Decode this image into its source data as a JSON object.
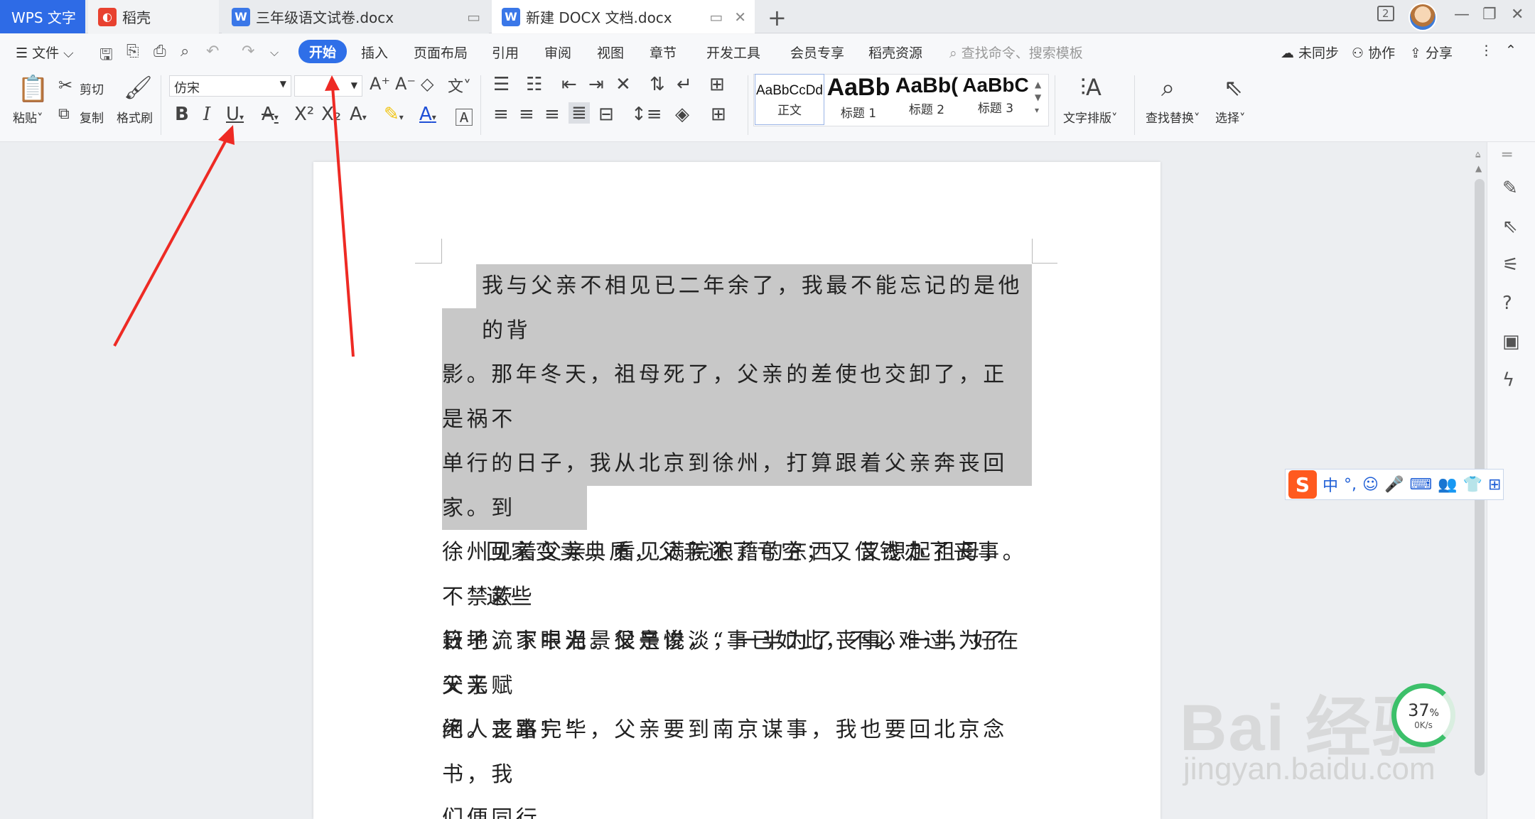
{
  "titlebar": {
    "app_tab": "WPS 文字",
    "tabs": [
      {
        "label": "稻壳"
      },
      {
        "label": "三年级语文试卷.docx"
      },
      {
        "label": "新建 DOCX 文档.docx"
      }
    ],
    "window_count": "2"
  },
  "menubar": {
    "file": "文件",
    "items": [
      "开始",
      "插入",
      "页面布局",
      "引用",
      "审阅",
      "视图",
      "章节",
      "开发工具",
      "会员专享",
      "稻壳资源"
    ],
    "active": "开始",
    "search_placeholder": "查找命令、搜索模板",
    "sync": "未同步",
    "collab": "协作",
    "share": "分享"
  },
  "ribbon": {
    "paste": "粘贴",
    "cut": "剪切",
    "copy": "复制",
    "format_painter": "格式刷",
    "font_name": "仿宋",
    "font_size": "",
    "styles": [
      {
        "sample": "AaBbCcDd",
        "label": "正文"
      },
      {
        "sample": "AaBb",
        "label": "标题 1"
      },
      {
        "sample": "AaBb(",
        "label": "标题 2"
      },
      {
        "sample": "AaBbC",
        "label": "标题 3"
      }
    ],
    "text_layout": "文字排版",
    "find_replace": "查找替换",
    "select": "选择"
  },
  "document": {
    "para1_lines": [
      "我与父亲不相见已二年余了，我最不能忘记的是他的背",
      "影。那年冬天，祖母死了，父亲的差使也交卸了，正是祸不",
      "单行的日子，我从北京到徐州，打算跟着父亲奔丧回家。到",
      "徐州见着父亲，看见满院狼藉的东西，又想起祖母，不禁簌",
      "簌地流下眼泪。父亲说，“事已如此，不必难过，好在天无",
      "绝人之路！”"
    ],
    "para2_lines": [
      "回家变卖典质，父亲还了亏空；又借钱办了丧事。这些",
      "日子，家中光景很是惨淡，一半为了丧事，一半为了父亲赋",
      "闲。丧事完毕，父亲要到南京谋事，我也要回北京念书，我",
      "们便同行。"
    ]
  },
  "ime": {
    "logo": "S",
    "mode": "中"
  },
  "speed_widget": {
    "value": "37",
    "unit_symbol": "%",
    "rate": "0K/s"
  },
  "watermark": {
    "text": "Bai 经验",
    "url": "jingyan.baidu.com"
  },
  "colors": {
    "accent": "#2f6fe8",
    "arrow": "#ee2a24",
    "highlight": "#c8c8c8"
  }
}
